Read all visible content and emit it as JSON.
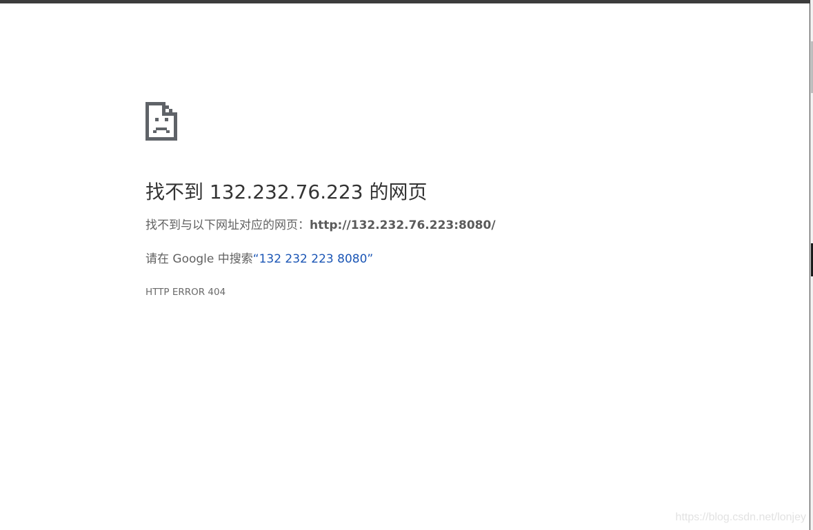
{
  "page": {
    "icon": "sad-file-icon",
    "title": "找不到 132.232.76.223 的网页",
    "url_prefix": "找不到与以下网址对应的网页：",
    "url": "http://132.232.76.223:8080/",
    "search_prefix": "请在 Google 中搜索",
    "search_open_quote": "“",
    "search_query": "132 232 223 8080",
    "search_close_quote": "”",
    "error_code": "HTTP ERROR 404"
  },
  "watermark": "https://blog.csdn.net/lonjey",
  "colors": {
    "title": "#333333",
    "body_text": "#616161",
    "link": "#1a55b5",
    "icon": "#5f6368"
  }
}
